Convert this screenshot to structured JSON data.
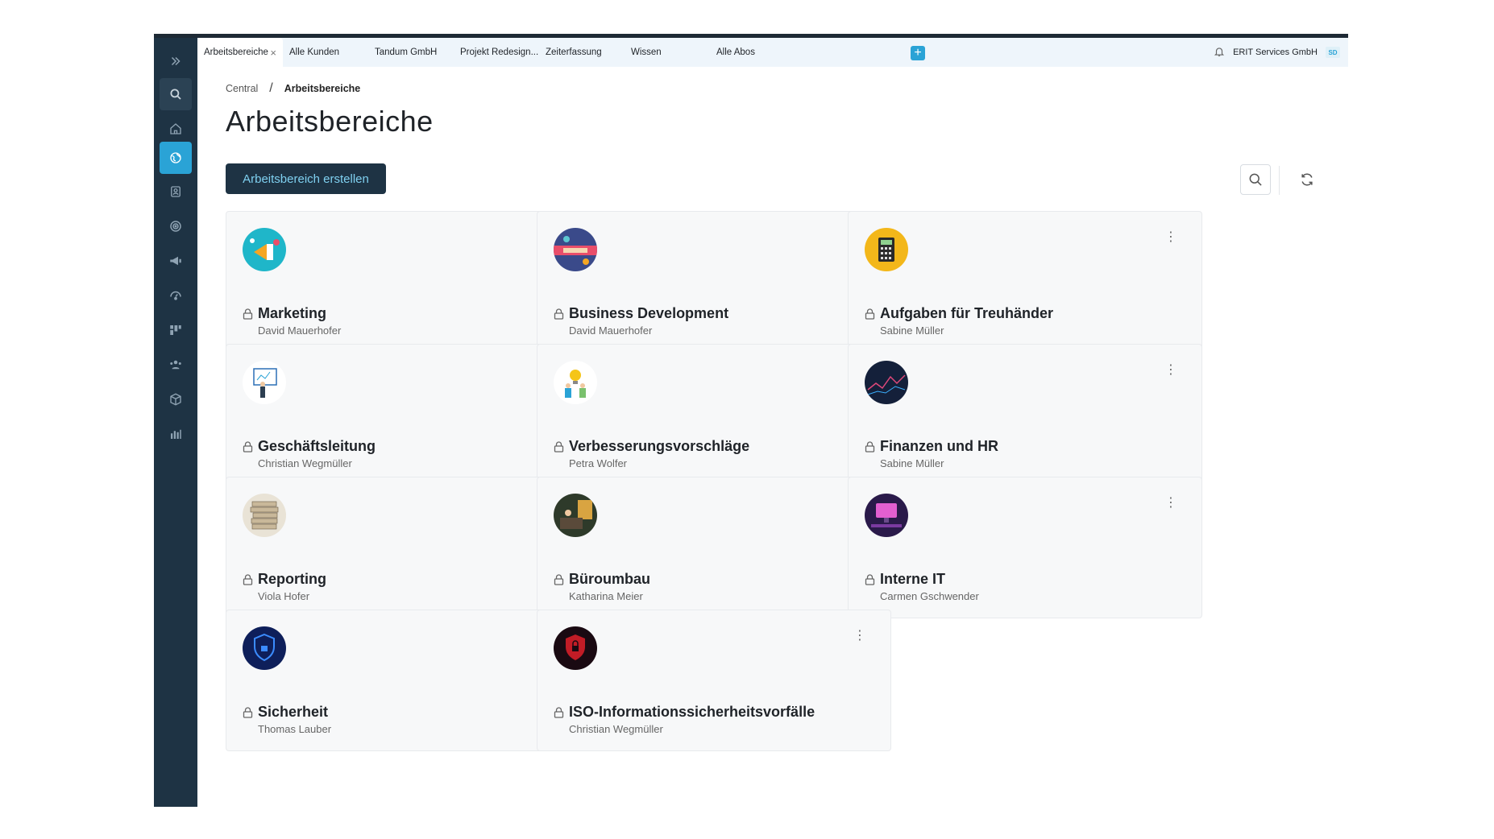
{
  "tabs": [
    {
      "label": "Arbeitsbereiche",
      "active": true
    },
    {
      "label": "Alle Kunden"
    },
    {
      "label": "Tandum GmbH"
    },
    {
      "label": "Projekt Redesign..."
    },
    {
      "label": "Zeiterfassung"
    },
    {
      "label": "Wissen"
    },
    {
      "label": "Alle Abos"
    }
  ],
  "tab_close_glyph": "×",
  "tab_add_glyph": "+",
  "company": {
    "name": "ERIT Services GmbH",
    "initials": "SD"
  },
  "breadcrumb": {
    "root": "Central",
    "separator": "/",
    "current": "Arbeitsbereiche"
  },
  "page_title": "Arbeitsbereiche",
  "create_button": "Arbeitsbereich erstellen",
  "sidebar_icons": [
    "expand-icon",
    "search-icon",
    "home-icon",
    "globe-icon",
    "contacts-icon",
    "target-icon",
    "megaphone-icon",
    "support-icon",
    "kanban-icon",
    "team-icon",
    "box-icon",
    "analytics-icon"
  ],
  "workspaces": [
    {
      "name": "Marketing",
      "owner": "David Mauerhofer",
      "icon": "megaphone-image",
      "colors": [
        "#1fb6c9",
        "#f5a623"
      ]
    },
    {
      "name": "Business Development",
      "owner": "David Mauerhofer",
      "icon": "handshake-image",
      "colors": [
        "#3a4a8a",
        "#e94e6a"
      ]
    },
    {
      "name": "Aufgaben für Treuhänder",
      "owner": "Sabine Müller",
      "icon": "calculator-image",
      "colors": [
        "#f3b71a",
        "#2a2a2a"
      ]
    },
    {
      "name": "Geschäftsleitung",
      "owner": "Christian Wegmüller",
      "icon": "presentation-image",
      "colors": [
        "#ffffff",
        "#2b6fb5"
      ]
    },
    {
      "name": "Verbesserungsvorschläge",
      "owner": "Petra Wolfer",
      "icon": "idea-image",
      "colors": [
        "#ffffff",
        "#f5c518"
      ]
    },
    {
      "name": "Finanzen und HR",
      "owner": "Sabine Müller",
      "icon": "data-image",
      "colors": [
        "#14203a",
        "#e0487a"
      ]
    },
    {
      "name": "Reporting",
      "owner": "Viola Hofer",
      "icon": "documents-image",
      "colors": [
        "#c9b89a",
        "#6b5a44"
      ]
    },
    {
      "name": "Büroumbau",
      "owner": "Katharina Meier",
      "icon": "office-image",
      "colors": [
        "#2e3a2a",
        "#d9a441"
      ]
    },
    {
      "name": "Interne IT",
      "owner": "Carmen Gschwender",
      "icon": "monitor-image",
      "colors": [
        "#2a1a4a",
        "#e25fd0"
      ]
    },
    {
      "name": "Sicherheit",
      "owner": "Thomas Lauber",
      "icon": "shield-image",
      "colors": [
        "#0e1f5a",
        "#3b8cff"
      ]
    },
    {
      "name": "ISO-Informationssicherheitsvorfälle",
      "owner": "Christian Wegmüller",
      "icon": "lock-alert-image",
      "colors": [
        "#1a0a12",
        "#e0202a"
      ]
    }
  ],
  "card_menu_glyph": "⋮"
}
